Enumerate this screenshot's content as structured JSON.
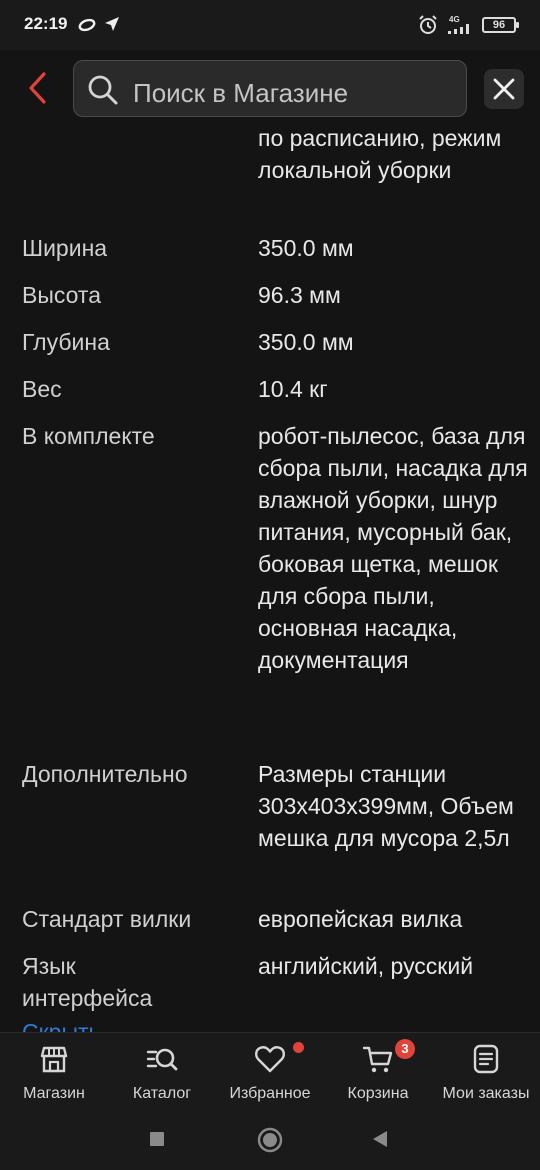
{
  "status_bar": {
    "time": "22:19",
    "network": "4G",
    "battery": "96",
    "icons": [
      "oval-icon",
      "location-arrow-icon",
      "alarm-icon",
      "signal-icon",
      "battery-icon"
    ]
  },
  "header": {
    "search_placeholder": "Поиск в Магазине",
    "icons": [
      "chevron-left-icon",
      "search-icon",
      "close-icon"
    ],
    "accent_color": "#e0433a"
  },
  "specs": {
    "rows": [
      {
        "label": "",
        "value": "по расписанию, режим локальной уборки"
      },
      {
        "label": "Ширина",
        "value": "350.0 мм"
      },
      {
        "label": "Высота",
        "value": "96.3 мм"
      },
      {
        "label": "Глубина",
        "value": "350.0 мм"
      },
      {
        "label": "Вес",
        "value": "10.4 кг"
      },
      {
        "label": "В комплекте",
        "value": "робот-пылесос, база для сбора пыли, насадка для влажной уборки, шнур питания, мусорный бак, боковая щетка, мешок для сбора пыли, основная насадка, документация"
      },
      {
        "label": "Дополнительно",
        "value": "Размеры станции 303х403х399мм, Объем мешка для мусора 2,5л"
      },
      {
        "label": "Стандарт вилки",
        "value": "европейская вилка"
      },
      {
        "label": "Язык интерфейса",
        "value": "английский, русский"
      }
    ],
    "hide_link": "Скрыть"
  },
  "bottom_nav": {
    "items": [
      {
        "label": "Магазин",
        "icon": "store-icon"
      },
      {
        "label": "Каталог",
        "icon": "catalog-search-icon"
      },
      {
        "label": "Избранное",
        "icon": "heart-icon"
      },
      {
        "label": "Корзина",
        "icon": "cart-icon"
      },
      {
        "label": "Мои заказы",
        "icon": "orders-icon"
      }
    ],
    "cart_count": "3"
  },
  "system_nav": {
    "icons": [
      "square-recents-icon",
      "circle-home-icon",
      "triangle-back-icon"
    ]
  }
}
